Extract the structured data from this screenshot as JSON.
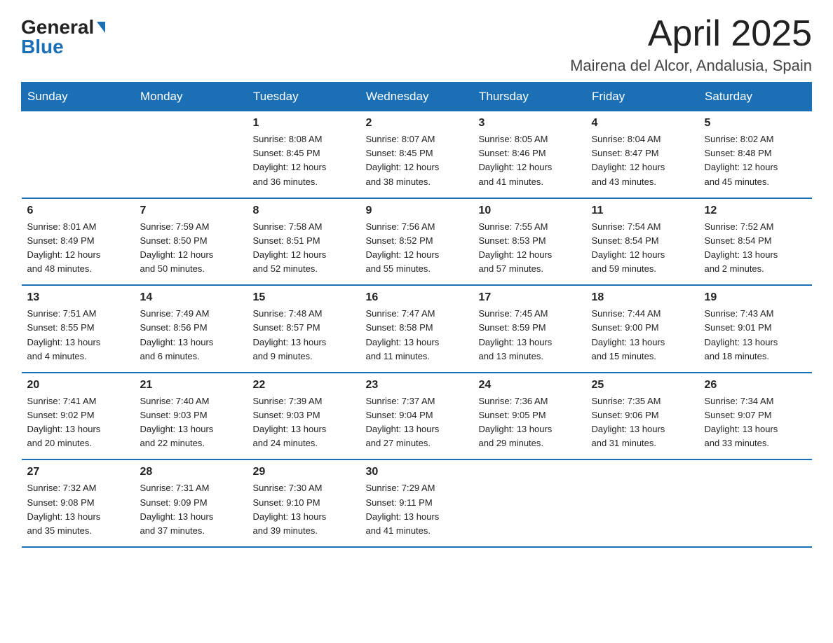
{
  "logo": {
    "general": "General",
    "blue": "Blue"
  },
  "header": {
    "month": "April 2025",
    "location": "Mairena del Alcor, Andalusia, Spain"
  },
  "weekdays": [
    "Sunday",
    "Monday",
    "Tuesday",
    "Wednesday",
    "Thursday",
    "Friday",
    "Saturday"
  ],
  "weeks": [
    [
      {
        "day": "",
        "info": ""
      },
      {
        "day": "",
        "info": ""
      },
      {
        "day": "1",
        "info": "Sunrise: 8:08 AM\nSunset: 8:45 PM\nDaylight: 12 hours\nand 36 minutes."
      },
      {
        "day": "2",
        "info": "Sunrise: 8:07 AM\nSunset: 8:45 PM\nDaylight: 12 hours\nand 38 minutes."
      },
      {
        "day": "3",
        "info": "Sunrise: 8:05 AM\nSunset: 8:46 PM\nDaylight: 12 hours\nand 41 minutes."
      },
      {
        "day": "4",
        "info": "Sunrise: 8:04 AM\nSunset: 8:47 PM\nDaylight: 12 hours\nand 43 minutes."
      },
      {
        "day": "5",
        "info": "Sunrise: 8:02 AM\nSunset: 8:48 PM\nDaylight: 12 hours\nand 45 minutes."
      }
    ],
    [
      {
        "day": "6",
        "info": "Sunrise: 8:01 AM\nSunset: 8:49 PM\nDaylight: 12 hours\nand 48 minutes."
      },
      {
        "day": "7",
        "info": "Sunrise: 7:59 AM\nSunset: 8:50 PM\nDaylight: 12 hours\nand 50 minutes."
      },
      {
        "day": "8",
        "info": "Sunrise: 7:58 AM\nSunset: 8:51 PM\nDaylight: 12 hours\nand 52 minutes."
      },
      {
        "day": "9",
        "info": "Sunrise: 7:56 AM\nSunset: 8:52 PM\nDaylight: 12 hours\nand 55 minutes."
      },
      {
        "day": "10",
        "info": "Sunrise: 7:55 AM\nSunset: 8:53 PM\nDaylight: 12 hours\nand 57 minutes."
      },
      {
        "day": "11",
        "info": "Sunrise: 7:54 AM\nSunset: 8:54 PM\nDaylight: 12 hours\nand 59 minutes."
      },
      {
        "day": "12",
        "info": "Sunrise: 7:52 AM\nSunset: 8:54 PM\nDaylight: 13 hours\nand 2 minutes."
      }
    ],
    [
      {
        "day": "13",
        "info": "Sunrise: 7:51 AM\nSunset: 8:55 PM\nDaylight: 13 hours\nand 4 minutes."
      },
      {
        "day": "14",
        "info": "Sunrise: 7:49 AM\nSunset: 8:56 PM\nDaylight: 13 hours\nand 6 minutes."
      },
      {
        "day": "15",
        "info": "Sunrise: 7:48 AM\nSunset: 8:57 PM\nDaylight: 13 hours\nand 9 minutes."
      },
      {
        "day": "16",
        "info": "Sunrise: 7:47 AM\nSunset: 8:58 PM\nDaylight: 13 hours\nand 11 minutes."
      },
      {
        "day": "17",
        "info": "Sunrise: 7:45 AM\nSunset: 8:59 PM\nDaylight: 13 hours\nand 13 minutes."
      },
      {
        "day": "18",
        "info": "Sunrise: 7:44 AM\nSunset: 9:00 PM\nDaylight: 13 hours\nand 15 minutes."
      },
      {
        "day": "19",
        "info": "Sunrise: 7:43 AM\nSunset: 9:01 PM\nDaylight: 13 hours\nand 18 minutes."
      }
    ],
    [
      {
        "day": "20",
        "info": "Sunrise: 7:41 AM\nSunset: 9:02 PM\nDaylight: 13 hours\nand 20 minutes."
      },
      {
        "day": "21",
        "info": "Sunrise: 7:40 AM\nSunset: 9:03 PM\nDaylight: 13 hours\nand 22 minutes."
      },
      {
        "day": "22",
        "info": "Sunrise: 7:39 AM\nSunset: 9:03 PM\nDaylight: 13 hours\nand 24 minutes."
      },
      {
        "day": "23",
        "info": "Sunrise: 7:37 AM\nSunset: 9:04 PM\nDaylight: 13 hours\nand 27 minutes."
      },
      {
        "day": "24",
        "info": "Sunrise: 7:36 AM\nSunset: 9:05 PM\nDaylight: 13 hours\nand 29 minutes."
      },
      {
        "day": "25",
        "info": "Sunrise: 7:35 AM\nSunset: 9:06 PM\nDaylight: 13 hours\nand 31 minutes."
      },
      {
        "day": "26",
        "info": "Sunrise: 7:34 AM\nSunset: 9:07 PM\nDaylight: 13 hours\nand 33 minutes."
      }
    ],
    [
      {
        "day": "27",
        "info": "Sunrise: 7:32 AM\nSunset: 9:08 PM\nDaylight: 13 hours\nand 35 minutes."
      },
      {
        "day": "28",
        "info": "Sunrise: 7:31 AM\nSunset: 9:09 PM\nDaylight: 13 hours\nand 37 minutes."
      },
      {
        "day": "29",
        "info": "Sunrise: 7:30 AM\nSunset: 9:10 PM\nDaylight: 13 hours\nand 39 minutes."
      },
      {
        "day": "30",
        "info": "Sunrise: 7:29 AM\nSunset: 9:11 PM\nDaylight: 13 hours\nand 41 minutes."
      },
      {
        "day": "",
        "info": ""
      },
      {
        "day": "",
        "info": ""
      },
      {
        "day": "",
        "info": ""
      }
    ]
  ]
}
